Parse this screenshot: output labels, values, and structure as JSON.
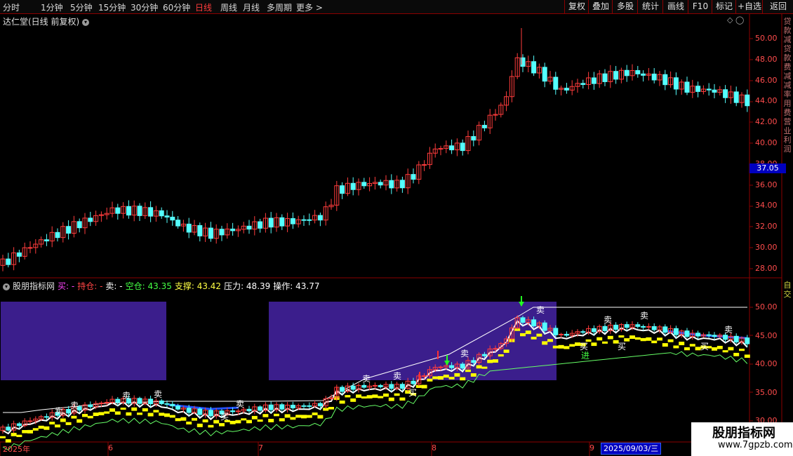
{
  "toolbar": {
    "periods": [
      "分时",
      "1分钟",
      "5分钟",
      "15分钟",
      "30分钟",
      "60分钟",
      "日线",
      "周线",
      "月线",
      "多周期",
      "更多 >"
    ],
    "active": "日线",
    "right_buttons": [
      "复权",
      "叠加",
      "多股",
      "统计",
      "画线",
      "F10",
      "标记",
      "+自选",
      "返回"
    ]
  },
  "kline": {
    "title": "达仁堂(日线 前复权)",
    "y_ticks": [
      "50.00",
      "48.00",
      "46.00",
      "44.00",
      "42.00",
      "40.00",
      "38.00",
      "36.00",
      "34.00",
      "32.00",
      "30.00",
      "28.00"
    ],
    "current_price": "37.05",
    "right_strip": "贷款减贷款费减减率用费营业利润"
  },
  "indicator": {
    "name": "股朋指标网",
    "fields": [
      {
        "label": "买:",
        "value": "-",
        "color": "#ff44ff"
      },
      {
        "label": "持仓:",
        "value": "-",
        "color": "#ff4444"
      },
      {
        "label": "卖:",
        "value": "-",
        "color": "#ffffff"
      },
      {
        "label": "空仓:",
        "value": "43.35",
        "color": "#44ff44"
      },
      {
        "label": "支撑:",
        "value": "43.42",
        "color": "#ffff44"
      },
      {
        "label": "压力:",
        "value": "48.39",
        "color": "#ffffff"
      },
      {
        "label": "操作:",
        "value": "43.77",
        "color": "#ffffff"
      }
    ],
    "y_ticks": [
      "50.00",
      "45.00",
      "40.00",
      "35.00",
      "30.00"
    ],
    "right_strip": "自交"
  },
  "timeline": {
    "labels": [
      "2025年",
      "6",
      "7",
      "8",
      "9"
    ],
    "cursor_date": "2025/09/03/三"
  },
  "signals": {
    "buy": "买",
    "sell": "卖",
    "enter": "进"
  },
  "watermark": {
    "line1": "股朋指标网",
    "line2": "www.7gpzb.com"
  },
  "colors": {
    "up": "#ff3c3c",
    "down": "#54ffff",
    "grid": "#8b0000",
    "bg": "#000000",
    "purple": "#3b1e8c",
    "yellow": "#ffff00",
    "ma_blue": "#2050ff",
    "ma_white": "#ffffff"
  }
}
